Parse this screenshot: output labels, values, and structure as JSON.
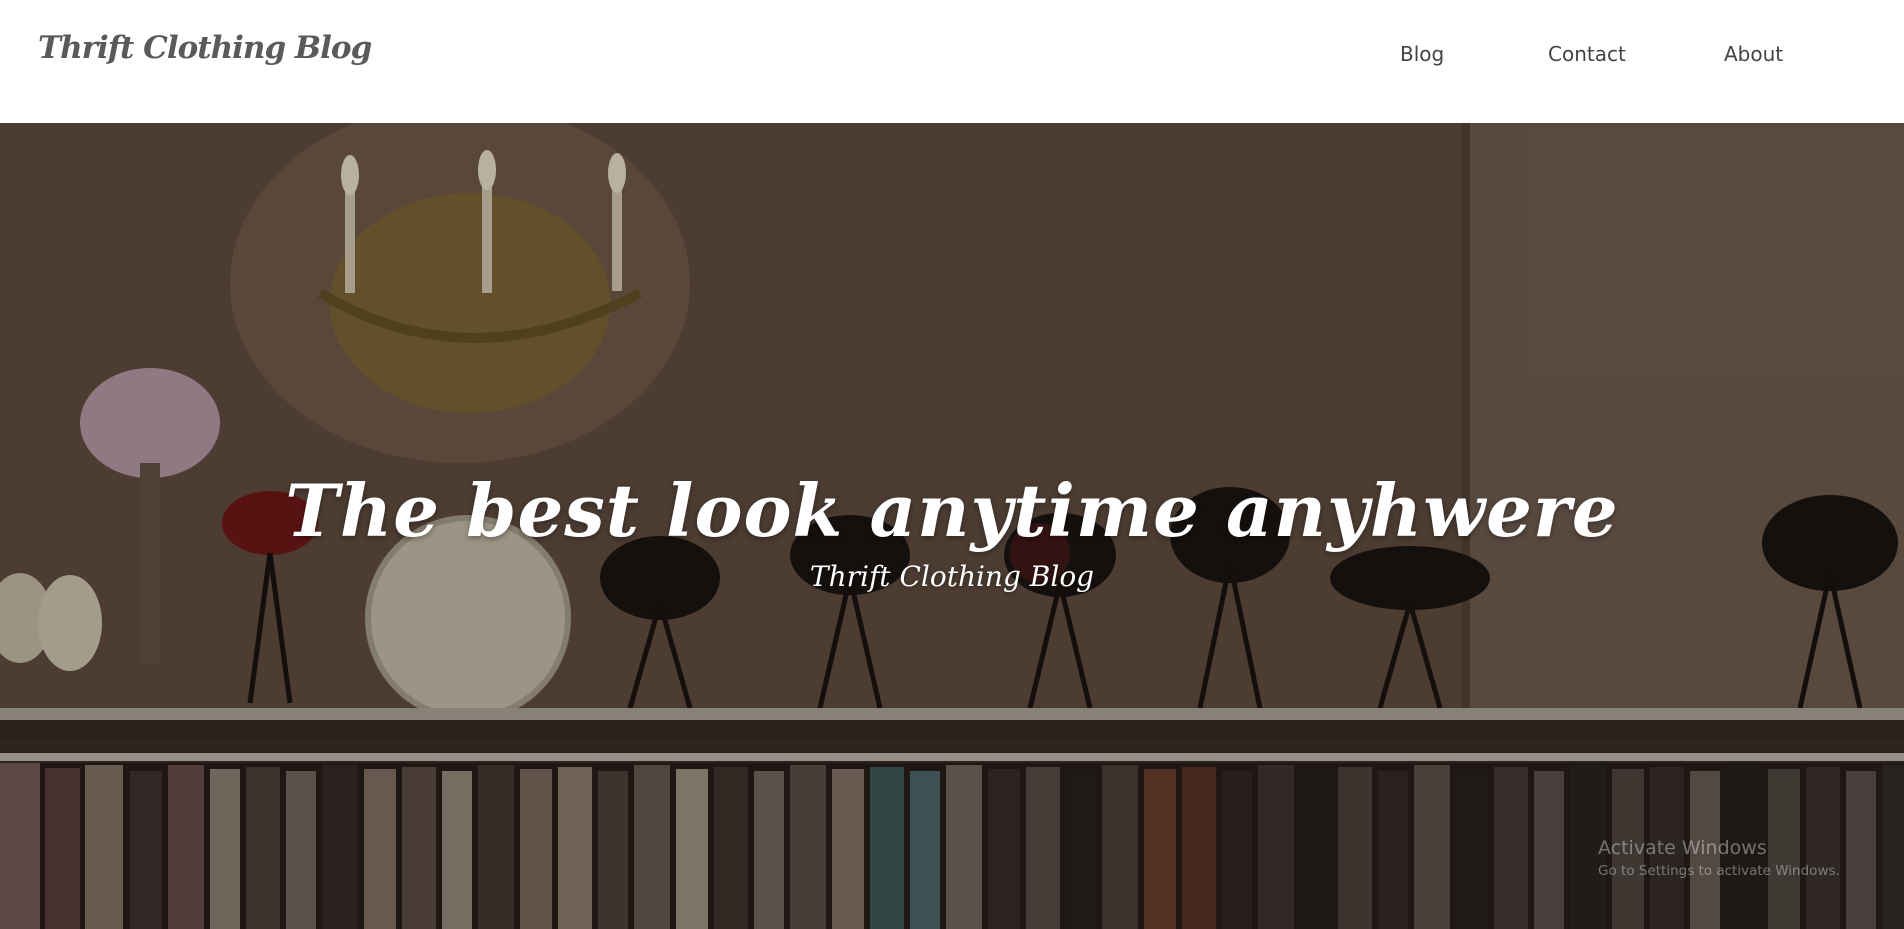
{
  "header": {
    "brand": "Thrift Clothing Blog",
    "nav": [
      {
        "label": "Blog"
      },
      {
        "label": "Contact"
      },
      {
        "label": "About"
      }
    ]
  },
  "hero": {
    "title": "The best look anytime anyhwere",
    "subtitle": "Thrift Clothing Blog"
  },
  "watermark": {
    "title": "Activate Windows",
    "subtitle": "Go to Settings to activate Windows."
  }
}
